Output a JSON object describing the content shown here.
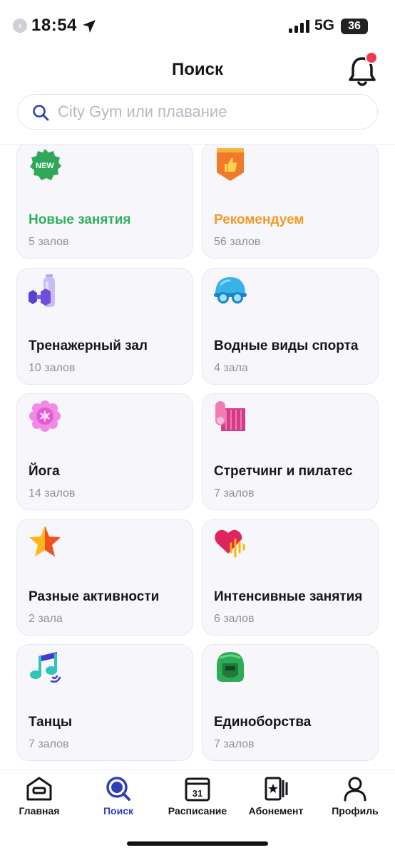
{
  "status": {
    "time": "18:54",
    "network": "5G",
    "battery": "36"
  },
  "header": {
    "title": "Поиск"
  },
  "search": {
    "placeholder": "City Gym или плавание"
  },
  "cards": [
    {
      "title": "Новые занятия",
      "subtitle": "5 залов",
      "icon": "new-badge-icon",
      "title_color": "#2fae5e",
      "badge": "NEW"
    },
    {
      "title": "Рекомендуем",
      "subtitle": "56 залов",
      "icon": "thumbs-up-ribbon-icon",
      "title_color": "#f29a24"
    },
    {
      "title": "Тренажерный зал",
      "subtitle": "10 залов",
      "icon": "dumbbell-bottle-icon",
      "title_color": "#15161a"
    },
    {
      "title": "Водные виды спорта",
      "subtitle": "4 зала",
      "icon": "swim-cap-icon",
      "title_color": "#15161a"
    },
    {
      "title": "Йога",
      "subtitle": "14 залов",
      "icon": "lotus-icon",
      "title_color": "#15161a"
    },
    {
      "title": "Стретчинг и пилатес",
      "subtitle": "7 залов",
      "icon": "yoga-mat-icon",
      "title_color": "#15161a"
    },
    {
      "title": "Разные активности",
      "subtitle": "2 зала",
      "icon": "star-icon",
      "title_color": "#15161a"
    },
    {
      "title": "Интенсивные занятия",
      "subtitle": "6 залов",
      "icon": "heart-pulse-icon",
      "title_color": "#15161a"
    },
    {
      "title": "Танцы",
      "subtitle": "7 залов",
      "icon": "music-note-icon",
      "title_color": "#15161a"
    },
    {
      "title": "Единоборства",
      "subtitle": "7 залов",
      "icon": "boxing-helmet-icon",
      "title_color": "#15161a"
    }
  ],
  "tabbar": {
    "active_color": "#2f3fb6",
    "items": [
      {
        "label": "Главная",
        "icon": "home-icon"
      },
      {
        "label": "Поиск",
        "icon": "search-icon",
        "active": true
      },
      {
        "label": "Расписание",
        "icon": "calendar-icon",
        "calendar_day": "31"
      },
      {
        "label": "Абонемент",
        "icon": "membership-card-icon"
      },
      {
        "label": "Профиль",
        "icon": "profile-icon"
      }
    ]
  }
}
